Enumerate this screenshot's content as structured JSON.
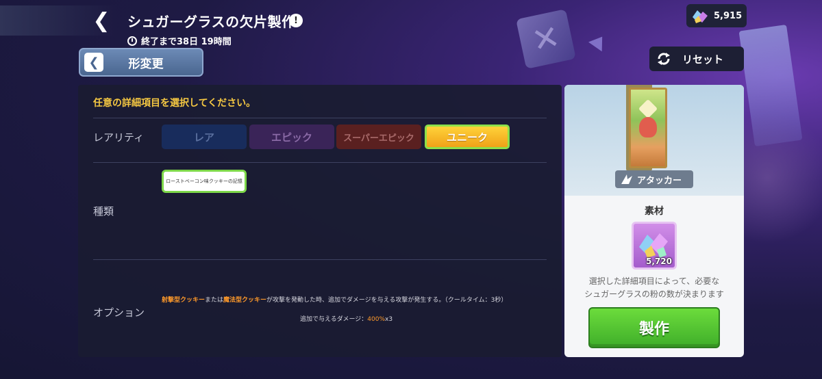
{
  "header": {
    "back_glyph": "❮",
    "title": "シュガーグラスの欠片製作",
    "info_glyph": "!",
    "timer": "終了まで38日 19時間"
  },
  "currency": {
    "value": "5,915"
  },
  "toolbar": {
    "change_label": "形変更",
    "change_glyph": "❮",
    "reset_label": "リセット"
  },
  "panel": {
    "instruction": "任意の詳細項目を選択してください。",
    "rarity_label": "レアリティ",
    "rarities": [
      "レア",
      "エピック",
      "スーパーエピック",
      "ユニーク"
    ],
    "selected_rarity": "ユニーク",
    "type_label": "種類",
    "type_chip": "ローストベーコン味クッキーの記憶",
    "option_label": "オプション",
    "option": {
      "l1_a": "射撃型クッキー",
      "l1_b": "または",
      "l1_c": "魔法型クッキー",
      "l1_d": "が攻撃を発動した時、追加でダメージを与える攻撃が発生する。（クールタイム：3秒）",
      "l2_a": "追加で与えるダメージ：",
      "l2_b": "400%",
      "l2_c": "x3"
    }
  },
  "card": {
    "role": "アタッカー",
    "material_title": "素材",
    "material_count": "5,720",
    "desc_line1": "選択した詳細項目によって、必要な",
    "desc_line2": "シュガーグラスの粉の数が決まります",
    "make_label": "製作"
  },
  "colors": {
    "accent_yellow": "#f5c842",
    "unique_orange": "#f0a218",
    "selected_green": "#7ed84a",
    "make_green": "#3fae2a"
  },
  "icons": [
    "back-icon",
    "info-icon",
    "clock-icon",
    "crystal-icon",
    "reset-icon",
    "attacker-icon",
    "powder-icon"
  ]
}
